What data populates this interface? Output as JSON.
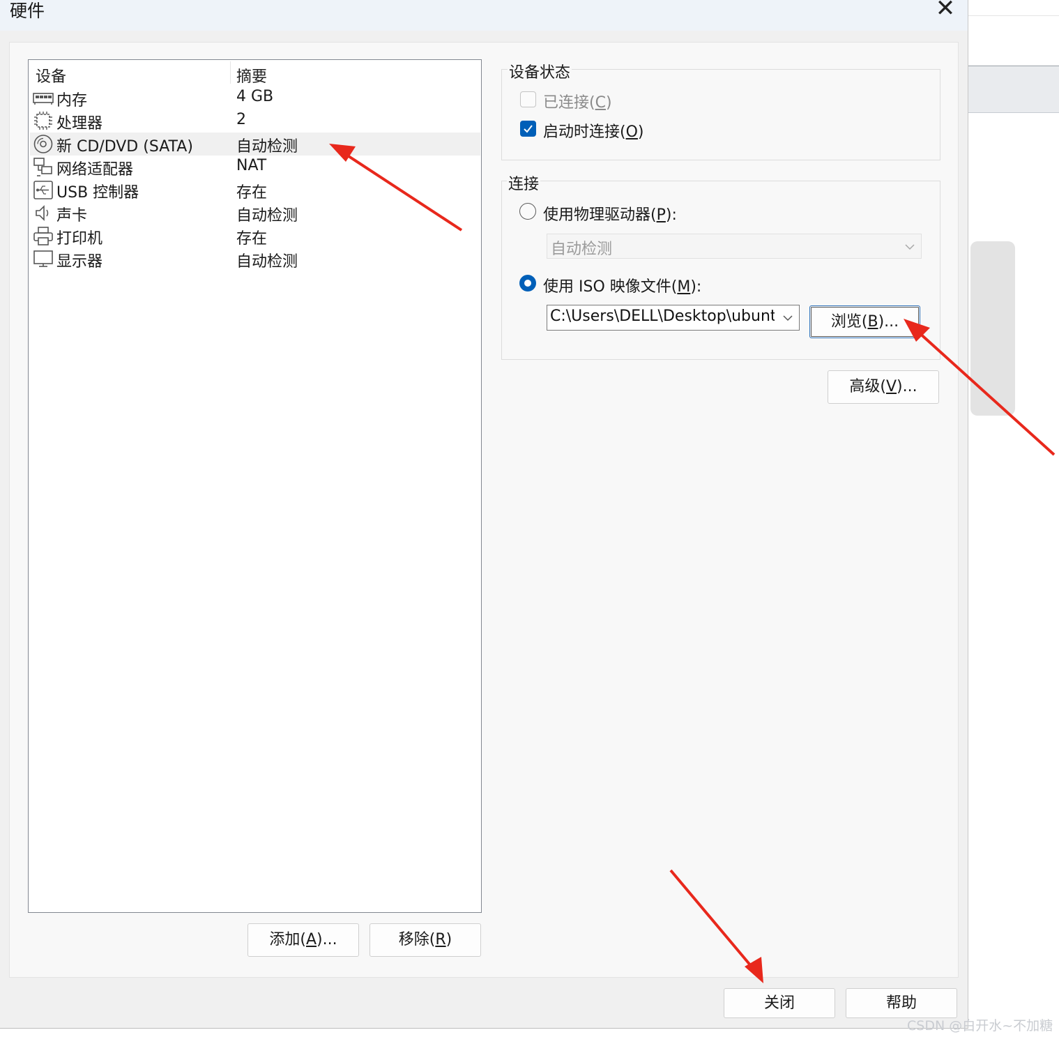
{
  "window": {
    "title": "硬件",
    "close_symbol": "✕"
  },
  "device_list": {
    "headers": {
      "device": "设备",
      "summary": "摘要"
    },
    "items": [
      {
        "icon": "memory-icon",
        "name": "内存",
        "summary": "4 GB"
      },
      {
        "icon": "processor-icon",
        "name": "处理器",
        "summary": "2"
      },
      {
        "icon": "cd-dvd-icon",
        "name": "新 CD/DVD (SATA)",
        "summary": "自动检测",
        "selected": true
      },
      {
        "icon": "network-adapter-icon",
        "name": "网络适配器",
        "summary": "NAT"
      },
      {
        "icon": "usb-controller-icon",
        "name": "USB 控制器",
        "summary": "存在"
      },
      {
        "icon": "sound-card-icon",
        "name": "声卡",
        "summary": "自动检测"
      },
      {
        "icon": "printer-icon",
        "name": "打印机",
        "summary": "存在"
      },
      {
        "icon": "display-icon",
        "name": "显示器",
        "summary": "自动检测"
      }
    ]
  },
  "list_buttons": {
    "add": {
      "label": "添加(",
      "key": "A",
      "suffix": ")..."
    },
    "remove": {
      "label": "移除(",
      "key": "R",
      "suffix": ")"
    }
  },
  "device_status": {
    "title": "设备状态",
    "connected": {
      "label": "已连接(",
      "key": "C",
      "suffix": ")",
      "checked": false,
      "enabled": false
    },
    "connect_at_power_on": {
      "label": "启动时连接(",
      "key": "O",
      "suffix": ")",
      "checked": true
    }
  },
  "connection": {
    "title": "连接",
    "physical": {
      "label": "使用物理驱动器(",
      "key": "P",
      "suffix": "):",
      "selected": false,
      "drive_value": "自动检测"
    },
    "iso": {
      "label": "使用 ISO 映像文件(",
      "key": "M",
      "suffix": "):",
      "selected": true,
      "path": "C:\\Users\\DELL\\Desktop\\ubuntu"
    },
    "browse": {
      "label": "浏览(",
      "key": "B",
      "suffix": ")..."
    }
  },
  "advanced": {
    "label": "高级(",
    "key": "V",
    "suffix": ")..."
  },
  "footer": {
    "close": "关闭",
    "help": "帮助"
  },
  "watermark": "CSDN @白开水~不加糖",
  "colors": {
    "accent": "#005fb8",
    "annotation_arrow": "#e8281c"
  }
}
